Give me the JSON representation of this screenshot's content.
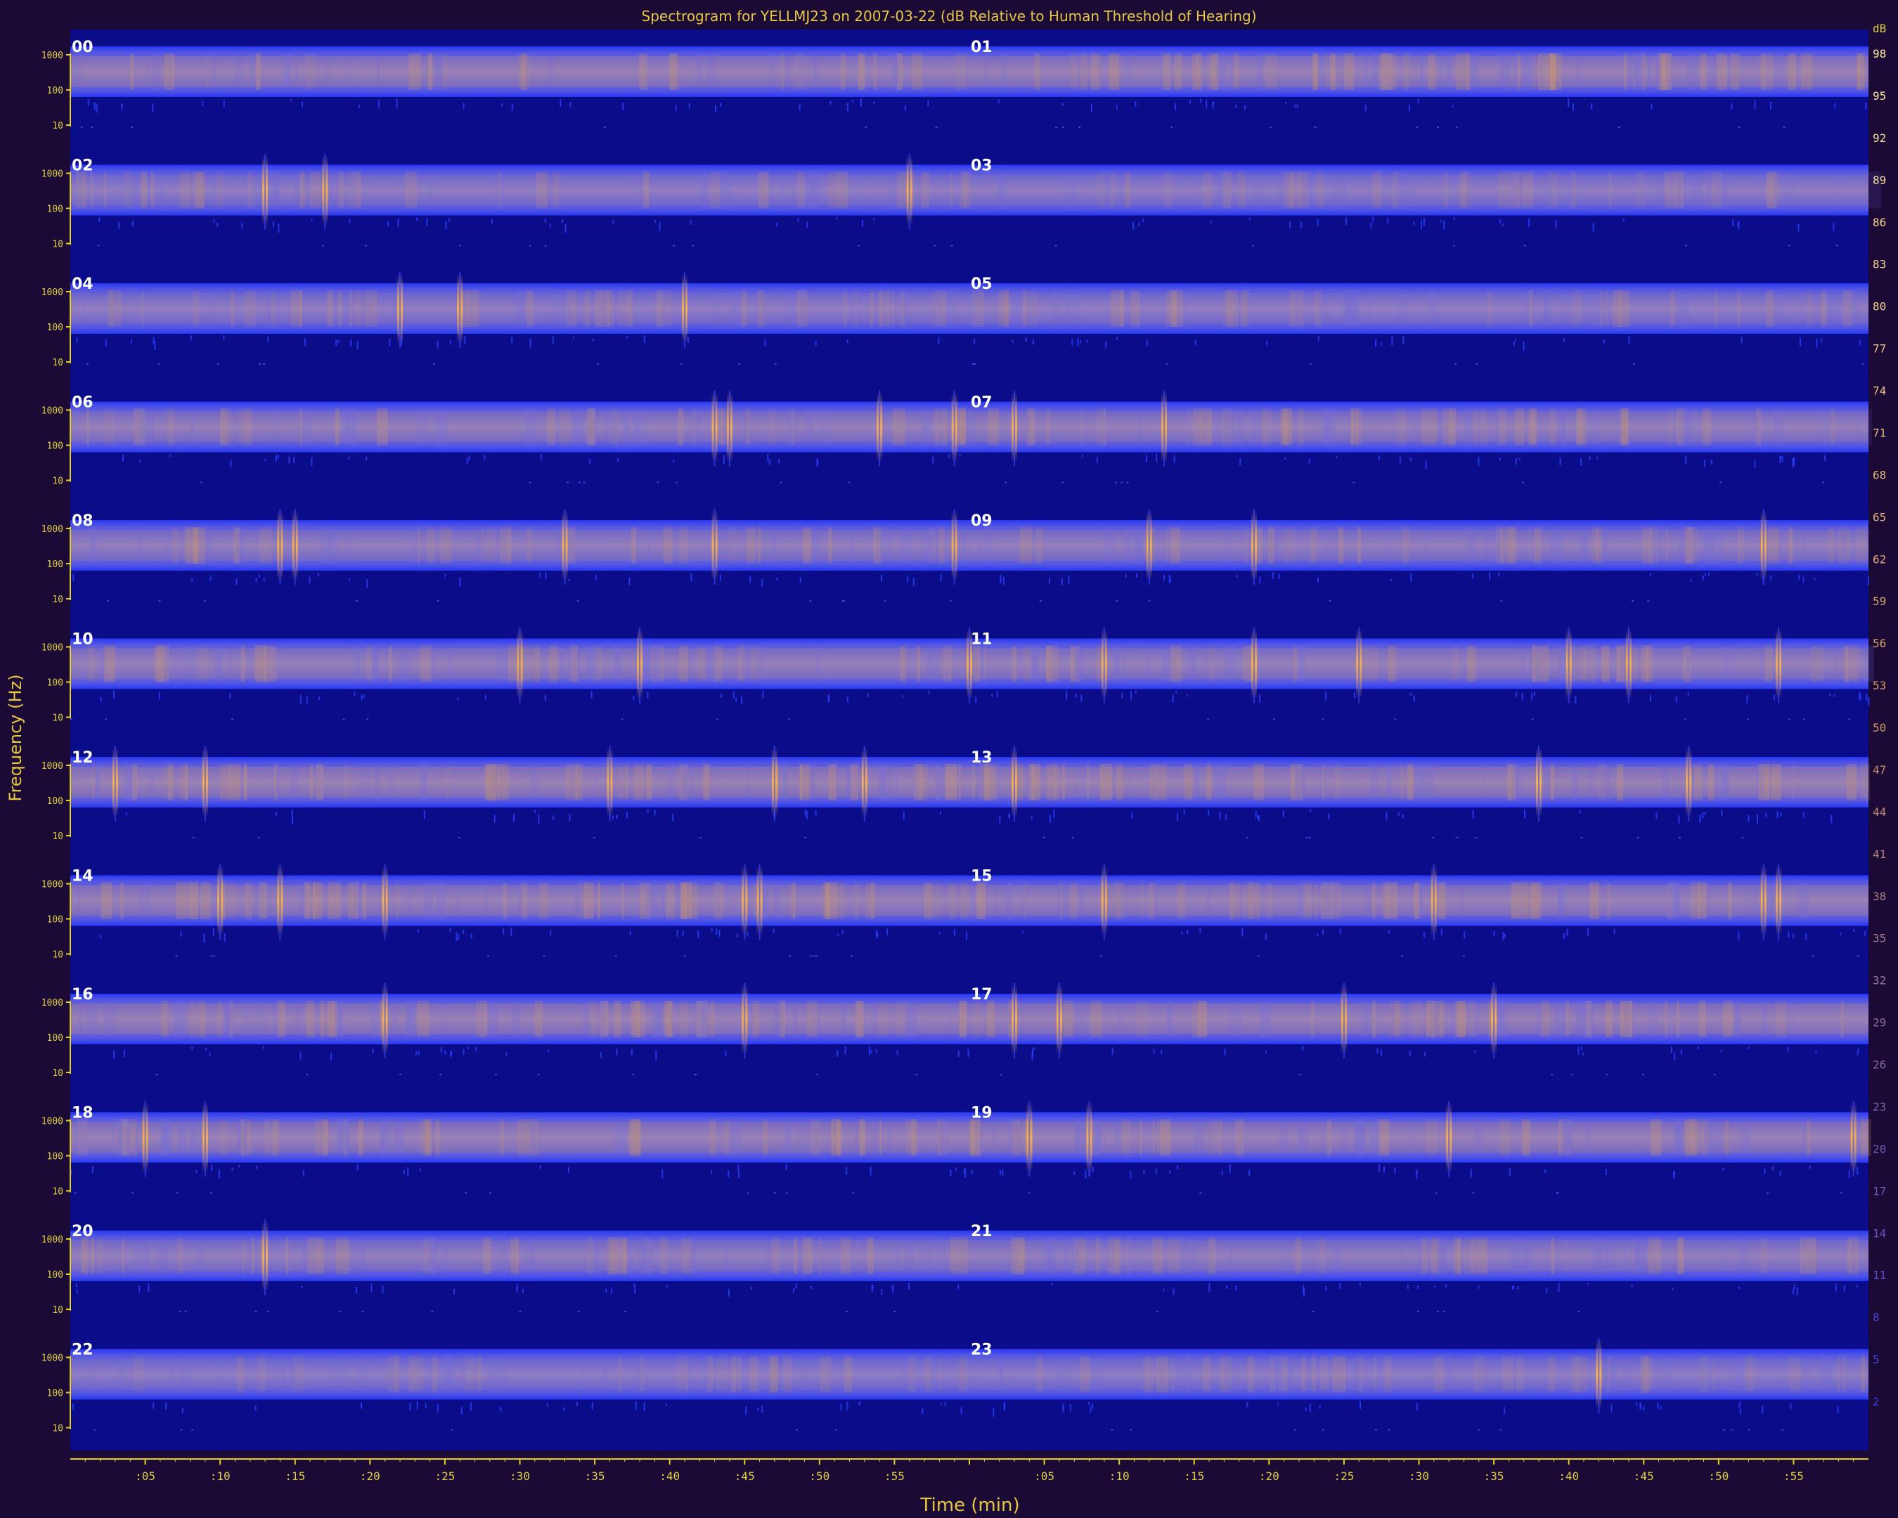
{
  "chart_data": {
    "type": "heatmap",
    "title": "Spectrogram for YELLMJ23 on 2007-03-22 (dB Relative to Human Threshold of Hearing)",
    "xlabel": "Time (min)",
    "ylabel": "Frequency (Hz)",
    "rows": [
      {
        "left": "00",
        "right": "01"
      },
      {
        "left": "02",
        "right": "03"
      },
      {
        "left": "04",
        "right": "05"
      },
      {
        "left": "06",
        "right": "07"
      },
      {
        "left": "08",
        "right": "09"
      },
      {
        "left": "10",
        "right": "11"
      },
      {
        "left": "12",
        "right": "13"
      },
      {
        "left": "14",
        "right": "15"
      },
      {
        "left": "16",
        "right": "17"
      },
      {
        "left": "18",
        "right": "19"
      },
      {
        "left": "20",
        "right": "21"
      },
      {
        "left": "22",
        "right": "23"
      }
    ],
    "y_ticks": [
      "1000",
      "100",
      "10"
    ],
    "x_ticks": [
      ":05",
      ":10",
      ":15",
      ":20",
      ":25",
      ":30",
      ":35",
      ":40",
      ":45",
      ":50",
      ":55",
      "",
      ":05",
      ":10",
      ":15",
      ":20",
      ":25",
      ":30",
      ":35",
      ":40",
      ":45",
      ":50",
      ":55"
    ],
    "x_range_min": [
      0,
      120
    ],
    "colorbar": {
      "unit": "dB",
      "ticks": [
        98,
        95,
        92,
        89,
        86,
        83,
        80,
        77,
        74,
        71,
        68,
        65,
        62,
        59,
        56,
        53,
        50,
        47,
        44,
        41,
        38,
        35,
        32,
        29,
        26,
        23,
        20,
        17,
        14,
        11,
        8,
        5,
        2
      ]
    },
    "band_intensity": [
      0.55,
      0.32,
      0.3,
      0.45,
      0.4,
      0.48,
      0.6,
      0.55,
      0.58,
      0.55,
      0.4,
      0.25
    ],
    "transients_min": [
      [],
      [
        13,
        17,
        56
      ],
      [
        22,
        26,
        41
      ],
      [
        43,
        44,
        54,
        59,
        63,
        73
      ],
      [
        14,
        15,
        33,
        43,
        59,
        72,
        79,
        113
      ],
      [
        30,
        38,
        60,
        69,
        79,
        86,
        100,
        104,
        114
      ],
      [
        3,
        9,
        36,
        47,
        53,
        63,
        98,
        108
      ],
      [
        10,
        14,
        21,
        45,
        46,
        69,
        91,
        113,
        114
      ],
      [
        21,
        45,
        63,
        66,
        85,
        95
      ],
      [
        5,
        9,
        64,
        68,
        92,
        119
      ],
      [
        13
      ],
      [
        102
      ]
    ],
    "colors": {
      "background": "#1b0a36",
      "plot_bg": "#0b0c8a",
      "band_edge": "#2a3cf0",
      "band_core": "#7a78d6",
      "hot": "#f0a040",
      "axis": "#e6d020"
    }
  }
}
